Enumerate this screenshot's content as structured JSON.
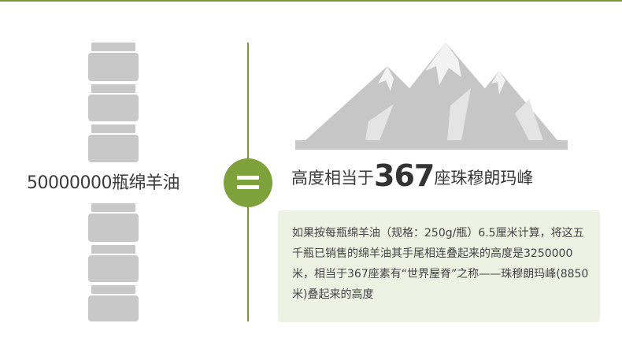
{
  "left_label": "50000000瓶绵羊油",
  "headline": {
    "prefix": "高度相当于",
    "number": "367",
    "suffix": "座珠穆朗玛峰"
  },
  "description": "如果按每瓶绵羊油（规格：250g/瓶）6.5厘米计算，将这五千瓶已销售的绵羊油其手尾相连叠起来的高度是3250000米，相当于367座素有“世界屋脊”之称——珠穆朗玛峰(8850米)叠起来的高度",
  "colors": {
    "accent": "#7ea13b",
    "line": "#7a9a3a",
    "bottle": "#c8c8c8",
    "mountain": "#c6c6c6",
    "snow": "#f2f2f2",
    "box": "#eef2e3"
  },
  "icons": [
    "bottle-stack-icon",
    "equals-icon",
    "mountain-icon"
  ]
}
